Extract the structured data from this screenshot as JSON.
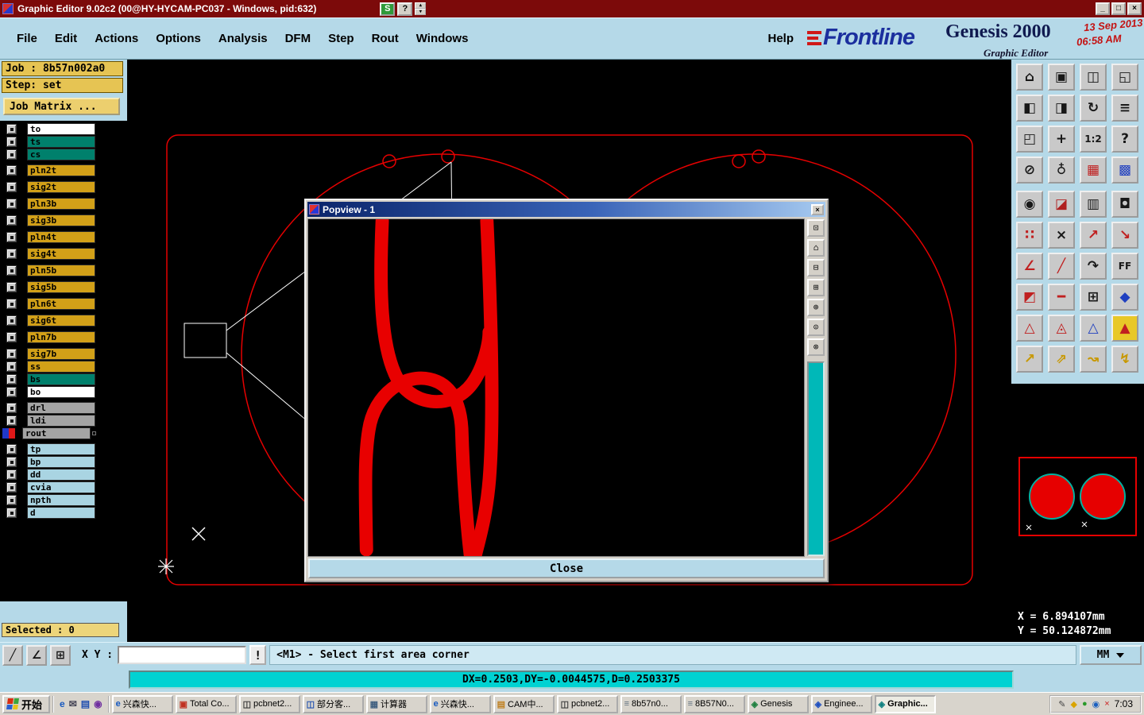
{
  "title_bar": {
    "title": "Graphic Editor 9.02c2 (00@HY-HYCAM-PC037 - Windows, pid:632)",
    "s_button": "S",
    "help_button": "?",
    "spinner_up": "▴",
    "spinner_down": "▾",
    "minimize": "_",
    "maximize": "□",
    "close": "×"
  },
  "menu_bar": {
    "menus": [
      "File",
      "Edit",
      "Actions",
      "Options",
      "Analysis",
      "DFM",
      "Step",
      "Rout",
      "Windows"
    ],
    "help": "Help"
  },
  "brand": {
    "frontline": "Frontline",
    "product": "Genesis 2000",
    "date": "13 Sep 2013",
    "time": "06:58 AM",
    "subtitle": "Graphic Editor"
  },
  "job_panel": {
    "job": "Job : 8b57n002a0",
    "step": "Step: set",
    "matrix_button": "Job Matrix ...",
    "selected": "Selected : 0"
  },
  "layers": [
    {
      "name": "to",
      "bg": "#ffffff"
    },
    {
      "name": "ts",
      "bg": "#00806c"
    },
    {
      "name": "cs",
      "bg": "#00806c"
    },
    {
      "name": "pln2t",
      "bg": "#d2a018"
    },
    {
      "name": "sig2t",
      "bg": "#d2a018"
    },
    {
      "name": "pln3b",
      "bg": "#d2a018"
    },
    {
      "name": "sig3b",
      "bg": "#d2a018"
    },
    {
      "name": "pln4t",
      "bg": "#d2a018"
    },
    {
      "name": "sig4t",
      "bg": "#d2a018"
    },
    {
      "name": "pln5b",
      "bg": "#d2a018"
    },
    {
      "name": "sig5b",
      "bg": "#d2a018"
    },
    {
      "name": "pln6t",
      "bg": "#d2a018"
    },
    {
      "name": "sig6t",
      "bg": "#d2a018"
    },
    {
      "name": "pln7b",
      "bg": "#d2a018"
    },
    {
      "name": "sig7b",
      "bg": "#d2a018"
    },
    {
      "name": "ss",
      "bg": "#d2a018"
    },
    {
      "name": "bs",
      "bg": "#00806c"
    },
    {
      "name": "bo",
      "bg": "#ffffff"
    },
    {
      "name": "drl",
      "bg": "#a4a4a4"
    },
    {
      "name": "ldi",
      "bg": "#a4a4a4"
    },
    {
      "name": "rout",
      "bg": "#a4a4a4"
    },
    {
      "name": "tp",
      "bg": "#a9d4e2"
    },
    {
      "name": "bp",
      "bg": "#a9d4e2"
    },
    {
      "name": "dd",
      "bg": "#a9d4e2"
    },
    {
      "name": "cvia",
      "bg": "#a9d4e2"
    },
    {
      "name": "npth",
      "bg": "#a9d4e2"
    },
    {
      "name": "d",
      "bg": "#a9d4e2"
    }
  ],
  "popview": {
    "title": "Popview - 1",
    "close_glyph": "×",
    "close_button": "Close",
    "side_buttons": [
      {
        "glyph": "⊡"
      },
      {
        "glyph": "⌂"
      },
      {
        "glyph": "⊟"
      },
      {
        "glyph": "⊞"
      },
      {
        "glyph": "⊕"
      },
      {
        "glyph": "⊙"
      },
      {
        "glyph": "⊗"
      }
    ]
  },
  "right_toolbar": {
    "icons": [
      {
        "glyph": "⌂",
        "color": "#181818"
      },
      {
        "glyph": "▣",
        "color": "#181818"
      },
      {
        "glyph": "◫",
        "color": "#181818"
      },
      {
        "glyph": "◱",
        "color": "#181818"
      },
      {
        "glyph": "◧",
        "color": "#181818"
      },
      {
        "glyph": "◨",
        "color": "#181818"
      },
      {
        "glyph": "↻",
        "color": "#181818"
      },
      {
        "glyph": "≡",
        "color": "#181818"
      },
      {
        "glyph": "◰",
        "color": "#181818"
      },
      {
        "glyph": "+",
        "color": "#181818"
      },
      {
        "glyph": "1:2",
        "color": "#181818"
      },
      {
        "glyph": "?",
        "color": "#181818"
      },
      {
        "glyph": "⊘",
        "color": "#181818"
      },
      {
        "glyph": "♁",
        "color": "#181818"
      },
      {
        "glyph": "▦",
        "color": "#c02020"
      },
      {
        "glyph": "▩",
        "color": "#2040c0"
      },
      {
        "glyph": "◉",
        "color": "#181818"
      },
      {
        "glyph": "◪",
        "color": "#b02020"
      },
      {
        "glyph": "▥",
        "color": "#181818"
      },
      {
        "glyph": "◘",
        "color": "#181818"
      },
      {
        "glyph": "∷",
        "color": "#c02020"
      },
      {
        "glyph": "×",
        "color": "#181818"
      },
      {
        "glyph": "↗",
        "color": "#c02020"
      },
      {
        "glyph": "↘",
        "color": "#c02020"
      },
      {
        "glyph": "∠",
        "color": "#c02020"
      },
      {
        "glyph": "╱",
        "color": "#c02020"
      },
      {
        "glyph": "↷",
        "color": "#181818"
      },
      {
        "glyph": "FF",
        "color": "#181818"
      },
      {
        "glyph": "◩",
        "color": "#c02020"
      },
      {
        "glyph": "━",
        "color": "#c02020"
      },
      {
        "glyph": "⊞",
        "color": "#181818"
      },
      {
        "glyph": "◆",
        "color": "#2040c0"
      },
      {
        "glyph": "△",
        "color": "#c02020"
      },
      {
        "glyph": "◬",
        "color": "#c02020"
      },
      {
        "glyph": "△",
        "color": "#2040c0"
      },
      {
        "glyph": "▲",
        "color": "#c02020"
      },
      {
        "glyph": "↗",
        "color": "#c89800"
      },
      {
        "glyph": "⇗",
        "color": "#c89800"
      },
      {
        "glyph": "↝",
        "color": "#c89800"
      },
      {
        "glyph": "↯",
        "color": "#c89800"
      }
    ]
  },
  "status_panel": {
    "x_readout": "X = 6.894107mm",
    "y_readout": "Y = 50.124872mm"
  },
  "status_bar": {
    "tools": [
      {
        "glyph": "╱"
      },
      {
        "glyph": "∠"
      },
      {
        "glyph": "⊞"
      }
    ],
    "xy_label": "X Y :",
    "input_value": "",
    "alert_button": "!",
    "message": "<M1> - Select first area corner",
    "units": "MM"
  },
  "readout": "DX=0.2503,DY=-0.0044575,D=0.2503375",
  "taskbar": {
    "start": "开始",
    "quick_launch": [
      {
        "glyph": "e",
        "color": "#1558c0"
      },
      {
        "glyph": "✉",
        "color": "#444455"
      },
      {
        "glyph": "▤",
        "color": "#2050b0"
      },
      {
        "glyph": "◉",
        "color": "#7030a0"
      }
    ],
    "buttons": [
      {
        "label": "兴森快...",
        "glyph": "e",
        "color": "#1558c0"
      },
      {
        "label": "Total Co...",
        "glyph": "▣",
        "color": "#c03020"
      },
      {
        "label": "pcbnet2...",
        "glyph": "◫",
        "color": "#3a3a3a"
      },
      {
        "label": "部分客...",
        "glyph": "◫",
        "color": "#2050b0"
      },
      {
        "label": "计算器",
        "glyph": "▦",
        "color": "#406080"
      },
      {
        "label": "兴森快...",
        "glyph": "e",
        "color": "#1558c0"
      },
      {
        "label": "CAM中...",
        "glyph": "▤",
        "color": "#c08020"
      },
      {
        "label": "pcbnet2...",
        "glyph": "◫",
        "color": "#3a3a3a"
      },
      {
        "label": "8b57n0...",
        "glyph": "≡",
        "color": "#607080"
      },
      {
        "label": "8B57N0...",
        "glyph": "≡",
        "color": "#607080"
      },
      {
        "label": "Genesis",
        "glyph": "◈",
        "color": "#208040"
      },
      {
        "label": "Enginee...",
        "glyph": "◈",
        "color": "#2050c0"
      },
      {
        "label": "Graphic...",
        "glyph": "◈",
        "color": "#108080"
      }
    ],
    "tray_icons": [
      {
        "glyph": "✎",
        "color": "#444444"
      },
      {
        "glyph": "◆",
        "color": "#d9a400"
      },
      {
        "glyph": "●",
        "color": "#2a9a2a"
      },
      {
        "glyph": "◉",
        "color": "#1a60c0"
      },
      {
        "glyph": "×",
        "color": "#cc2020"
      }
    ],
    "time": "7:03"
  },
  "colors": {
    "outline": "#e60000",
    "trace": "#e80000",
    "white_marks": "#ffffff"
  }
}
